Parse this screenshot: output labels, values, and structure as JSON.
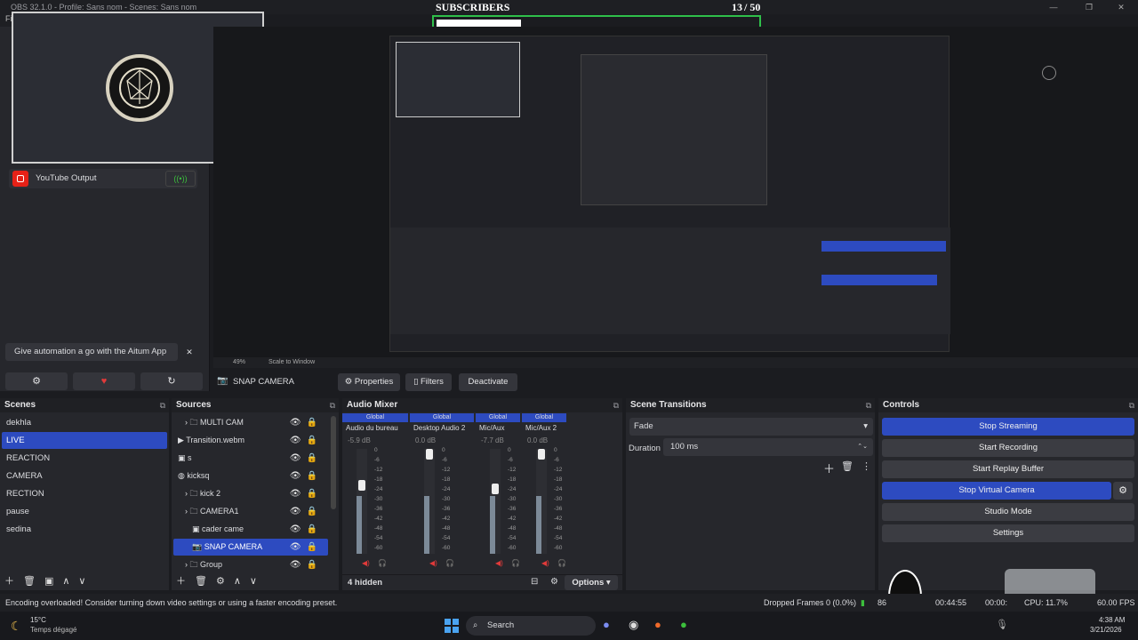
{
  "window": {
    "title": "OBS 32.1.0 - Profile: Sans nom - Scenes: Sans nom"
  },
  "subscribers": {
    "label": "SUBSCRIBERS",
    "count": "13",
    "goal": "/ 50"
  },
  "dock": {
    "youtube_label": "YouTube Output",
    "aitum_banner": "Give automation a go with the Aitum App",
    "close_glyph": "✕"
  },
  "preview_toolbar": {
    "zoom": "49%",
    "scale_mode": "Scale to Window"
  },
  "source_toolbar": {
    "source_name": "SNAP CAMERA",
    "properties": "Properties",
    "filters": "Filters",
    "deactivate": "Deactivate"
  },
  "scenes": {
    "title": "Scenes",
    "items": [
      "dekhla",
      "LIVE",
      "REACTION",
      "CAMERA",
      "RECTION",
      "pause",
      "sedina"
    ],
    "selected": "LIVE"
  },
  "sources": {
    "title": "Sources",
    "items": [
      {
        "label": "MULTI CAM",
        "icon": "folder-icon"
      },
      {
        "label": "Transition.webm",
        "icon": "play-icon"
      },
      {
        "label": "s",
        "icon": "image-icon"
      },
      {
        "label": "kicksq",
        "icon": "browser-icon"
      },
      {
        "label": "kick 2",
        "icon": "folder-icon"
      },
      {
        "label": "CAMERA1",
        "icon": "folder-icon"
      },
      {
        "label": "cader came",
        "icon": "image-icon"
      },
      {
        "label": "SNAP CAMERA",
        "icon": "camera-icon"
      },
      {
        "label": "Group",
        "icon": "folder-icon"
      }
    ],
    "selected": "SNAP CAMERA"
  },
  "audio_mixer": {
    "title": "Audio Mixer",
    "hidden_label": "4 hidden",
    "options_label": "Options",
    "channels": [
      {
        "scope": "Global",
        "name": "Audio du bureau",
        "db": "-5.9 dB"
      },
      {
        "scope": "Global",
        "name": "Desktop Audio 2",
        "db": "0.0 dB"
      },
      {
        "scope": "Global",
        "name": "Mic/Aux",
        "db": "-7.7 dB"
      },
      {
        "scope": "Global",
        "name": "Mic/Aux 2",
        "db": "0.0 dB"
      }
    ],
    "scale": [
      "0",
      "-6",
      "-12",
      "-18",
      "-24",
      "-30",
      "-36",
      "-42",
      "-48",
      "-54",
      "-60"
    ]
  },
  "transitions": {
    "title": "Scene Transitions",
    "selected": "Fade",
    "duration_label": "Duration",
    "duration_value": "100 ms"
  },
  "controls": {
    "title": "Controls",
    "stop_streaming": "Stop Streaming",
    "start_recording": "Start Recording",
    "start_replay": "Start Replay Buffer",
    "stop_virtual": "Stop Virtual Camera",
    "studio_mode": "Studio Mode",
    "settings": "Settings"
  },
  "status": {
    "message": "Encoding overloaded! Consider turning down video settings or using a faster encoding preset.",
    "dropped": "Dropped Frames 0 (0.0%)",
    "bitrate_partial": "86",
    "stream_time": "00:44:55",
    "rec_time": "00:00:",
    "cpu": "CPU: 11.7%",
    "fps": "60.00 FPS"
  },
  "taskbar": {
    "temperature": "15°C",
    "weather": "Temps dégagé",
    "search": "Search",
    "time": "4:38 AM",
    "date": "3/21/2026"
  },
  "colors": {
    "accent": "#2d4bc0",
    "green_frame": "#2fbf4a",
    "meter_green": "#3cbf3c"
  }
}
